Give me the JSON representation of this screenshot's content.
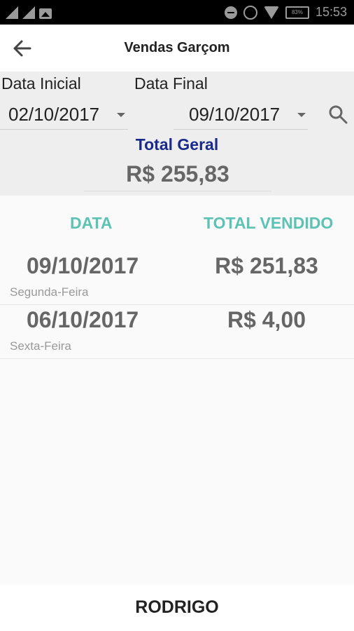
{
  "status_bar": {
    "time": "15:53",
    "battery": "83%",
    "icons": [
      "signal-icon",
      "signal-icon",
      "image-icon",
      "do-not-disturb-icon",
      "alarm-icon",
      "wifi-icon",
      "battery-icon"
    ]
  },
  "toolbar": {
    "title": "Vendas Garçom",
    "back_icon": "arrow-back-icon"
  },
  "filter": {
    "start_label": "Data Inicial",
    "end_label": "Data Final",
    "start_date": "02/10/2017",
    "end_date": "09/10/2017",
    "search_icon": "search-icon",
    "total_label": "Total Geral",
    "total_value": "R$ 255,83"
  },
  "table": {
    "headers": [
      "DATA",
      "TOTAL VENDIDO"
    ],
    "rows": [
      {
        "date": "09/10/2017",
        "weekday": "Segunda-Feira",
        "total": "R$ 251,83"
      },
      {
        "date": "06/10/2017",
        "weekday": "Sexta-Feira",
        "total": "R$ 4,00"
      }
    ]
  },
  "footer": {
    "name": "RODRIGO"
  },
  "colors": {
    "header_accent": "#5cc3b4",
    "total_title": "#1a2a8a",
    "status_bar": "#000000",
    "filter_bg": "#eeeeee"
  }
}
